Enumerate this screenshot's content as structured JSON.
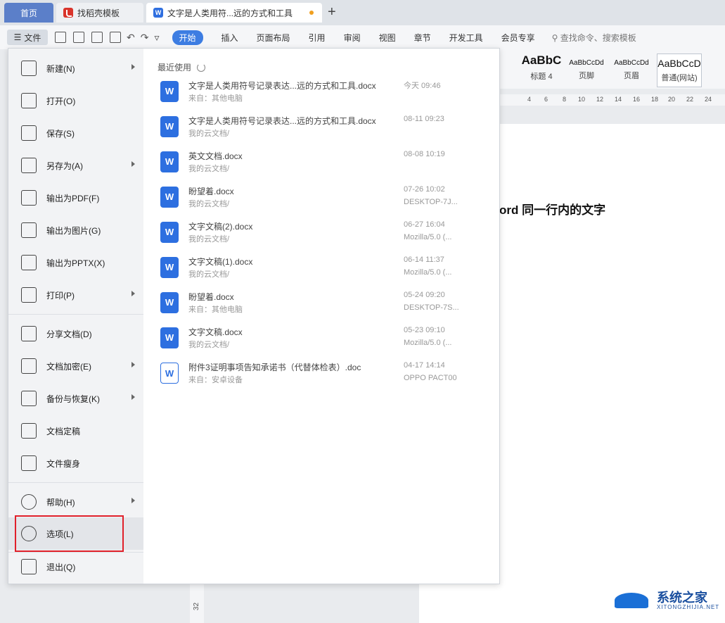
{
  "tabs": {
    "home": "首页",
    "daoke": "找稻壳模板",
    "doc": "文字是人类用符...远的方式和工具",
    "plus": "+"
  },
  "ribbon": {
    "file_label": "文件",
    "tabs": [
      "开始",
      "插入",
      "页面布局",
      "引用",
      "审阅",
      "视图",
      "章节",
      "开发工具",
      "会员专享"
    ],
    "search": "查找命令、搜索模板"
  },
  "styles": [
    {
      "preview": "AaBbC",
      "name": "标题 4"
    },
    {
      "preview": "AaBbCcDd",
      "name": "页脚"
    },
    {
      "preview": "AaBbCcDd",
      "name": "页眉"
    },
    {
      "preview": "AaBbCcD",
      "name": "普通(网站)"
    }
  ],
  "ruler_ticks": [
    "4",
    "6",
    "8",
    "10",
    "12",
    "14",
    "16",
    "18",
    "20",
    "22",
    "24"
  ],
  "page_text": "ord 同一行内的文字",
  "gutter_number": "32",
  "menu": {
    "items": [
      {
        "label": "新建(N)",
        "arrow": true
      },
      {
        "label": "打开(O)",
        "arrow": false
      },
      {
        "label": "保存(S)",
        "arrow": false
      },
      {
        "label": "另存为(A)",
        "arrow": true
      },
      {
        "label": "输出为PDF(F)",
        "arrow": false
      },
      {
        "label": "输出为图片(G)",
        "arrow": false
      },
      {
        "label": "输出为PPTX(X)",
        "arrow": false
      },
      {
        "label": "打印(P)",
        "arrow": true
      },
      {
        "label": "分享文档(D)",
        "arrow": false
      },
      {
        "label": "文档加密(E)",
        "arrow": true
      },
      {
        "label": "备份与恢复(K)",
        "arrow": true
      },
      {
        "label": "文档定稿",
        "arrow": false
      },
      {
        "label": "文件瘦身",
        "arrow": false
      },
      {
        "label": "帮助(H)",
        "arrow": true
      },
      {
        "label": "选项(L)",
        "arrow": false
      },
      {
        "label": "退出(Q)",
        "arrow": false
      }
    ],
    "recent_title": "最近使用",
    "recent": [
      {
        "name": "文字是人类用符号记录表达...远的方式和工具.docx",
        "src": "来自：其他电脑",
        "date": "今天  09:46",
        "dev": ""
      },
      {
        "name": "文字是人类用符号记录表达...远的方式和工具.docx",
        "src": "我的云文档/",
        "date": "08-11 09:23",
        "dev": ""
      },
      {
        "name": "英文文档.docx",
        "src": "我的云文档/",
        "date": "08-08 10:19",
        "dev": ""
      },
      {
        "name": "盼望着.docx",
        "src": "我的云文档/",
        "date": "07-26 10:02",
        "dev": "DESKTOP-7J..."
      },
      {
        "name": "文字文稿(2).docx",
        "src": "我的云文档/",
        "date": "06-27 16:04",
        "dev": "Mozilla/5.0 (..."
      },
      {
        "name": "文字文稿(1).docx",
        "src": "我的云文档/",
        "date": "06-14 11:37",
        "dev": "Mozilla/5.0 (..."
      },
      {
        "name": "盼望着.docx",
        "src": "来自：其他电脑",
        "date": "05-24 09:20",
        "dev": "DESKTOP-7S..."
      },
      {
        "name": "文字文稿.docx",
        "src": "我的云文档/",
        "date": "05-23 09:10",
        "dev": "Mozilla/5.0 (..."
      },
      {
        "name": "附件3证明事项告知承诺书（代替体检表）.doc",
        "src": "来自：安卓设备",
        "date": "04-17 14:14",
        "dev": "OPPO PACT00"
      }
    ]
  },
  "watermark": {
    "text": "系统之家",
    "sub": "XITONGZHIJIA.NET"
  }
}
